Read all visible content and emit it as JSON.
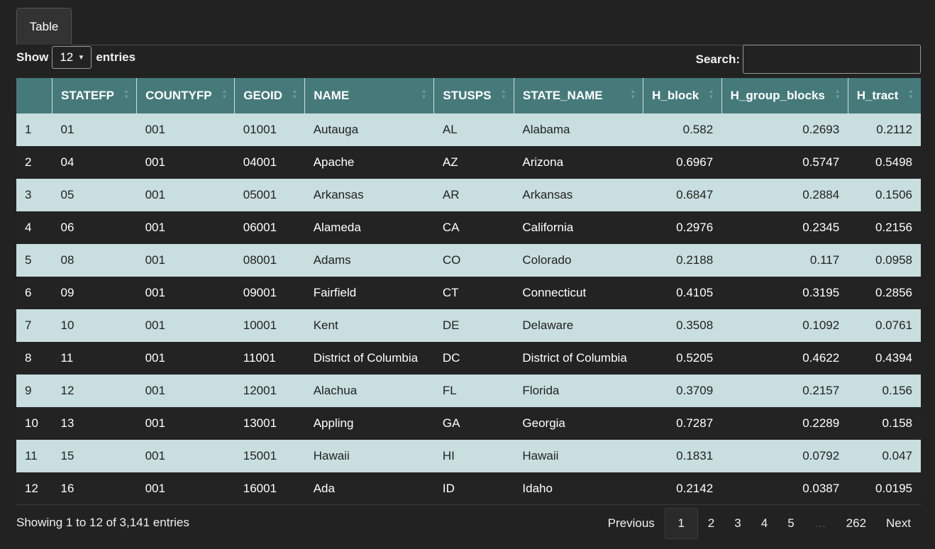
{
  "tabs": [
    {
      "label": "Table"
    }
  ],
  "length": {
    "show_label": "Show",
    "value": "12",
    "entries_label": "entries"
  },
  "search": {
    "label": "Search:",
    "value": ""
  },
  "table": {
    "columns": [
      "",
      "STATEFP",
      "COUNTYFP",
      "GEOID",
      "NAME",
      "STUSPS",
      "STATE_NAME",
      "H_block",
      "H_group_blocks",
      "H_tract"
    ],
    "rows": [
      [
        "1",
        "01",
        "001",
        "01001",
        "Autauga",
        "AL",
        "Alabama",
        "0.582",
        "0.2693",
        "0.2112"
      ],
      [
        "2",
        "04",
        "001",
        "04001",
        "Apache",
        "AZ",
        "Arizona",
        "0.6967",
        "0.5747",
        "0.5498"
      ],
      [
        "3",
        "05",
        "001",
        "05001",
        "Arkansas",
        "AR",
        "Arkansas",
        "0.6847",
        "0.2884",
        "0.1506"
      ],
      [
        "4",
        "06",
        "001",
        "06001",
        "Alameda",
        "CA",
        "California",
        "0.2976",
        "0.2345",
        "0.2156"
      ],
      [
        "5",
        "08",
        "001",
        "08001",
        "Adams",
        "CO",
        "Colorado",
        "0.2188",
        "0.117",
        "0.0958"
      ],
      [
        "6",
        "09",
        "001",
        "09001",
        "Fairfield",
        "CT",
        "Connecticut",
        "0.4105",
        "0.3195",
        "0.2856"
      ],
      [
        "7",
        "10",
        "001",
        "10001",
        "Kent",
        "DE",
        "Delaware",
        "0.3508",
        "0.1092",
        "0.0761"
      ],
      [
        "8",
        "11",
        "001",
        "11001",
        "District of Columbia",
        "DC",
        "District of Columbia",
        "0.5205",
        "0.4622",
        "0.4394"
      ],
      [
        "9",
        "12",
        "001",
        "12001",
        "Alachua",
        "FL",
        "Florida",
        "0.3709",
        "0.2157",
        "0.156"
      ],
      [
        "10",
        "13",
        "001",
        "13001",
        "Appling",
        "GA",
        "Georgia",
        "0.7287",
        "0.2289",
        "0.158"
      ],
      [
        "11",
        "15",
        "001",
        "15001",
        "Hawaii",
        "HI",
        "Hawaii",
        "0.1831",
        "0.0792",
        "0.047"
      ],
      [
        "12",
        "16",
        "001",
        "16001",
        "Ada",
        "ID",
        "Idaho",
        "0.2142",
        "0.0387",
        "0.0195"
      ]
    ]
  },
  "info": "Showing 1 to 12 of 3,141 entries",
  "pagination": {
    "previous": "Previous",
    "pages": [
      "1",
      "2",
      "3",
      "4",
      "5"
    ],
    "current": "1",
    "ellipsis": "…",
    "last": "262",
    "next": "Next"
  },
  "colors": {
    "header_bg": "#467a7a",
    "row_light": "#c9dede",
    "row_dark": "#232323",
    "page_bg": "#222222"
  }
}
